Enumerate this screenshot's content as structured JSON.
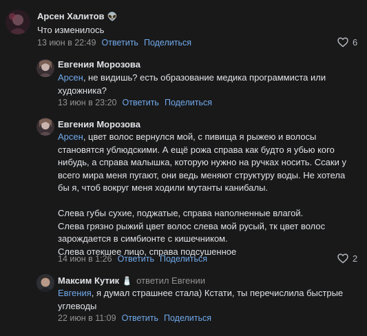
{
  "comments": [
    {
      "author": "Арсен Халитов",
      "badge": "👽",
      "text": "Что изменилось",
      "time": "13 июн в 22:49",
      "reply_label": "Ответить",
      "share_label": "Поделиться",
      "likes": "6"
    },
    {
      "author": "Евгения Морозова",
      "mention": "Арсен",
      "text": ", не видишь? есть образование медика программиста или\nхудожника?",
      "time": "13 июн в 23:20",
      "reply_label": "Ответить",
      "share_label": "Поделиться"
    },
    {
      "author": "Евгения Морозова",
      "mention": "Арсен",
      "text": ", цвет волос вернулся мой, с пивища я рыжею и волосы\nстановятся ублюдскими. А ещё рожа справа как будто я убью кого\nнибудь, а справа малышка, которую нужно на ручках носить. Ссаки у\nвсего мира меня пугают, они ведь меняют структуру воды. Не хотела\nбы я, чтоб вокруг меня ходили мутанты канибалы.\n\nСлева губы сухие, поджатые, справа наполненные влагой.\nСлева грязно рыжий цвет волос слева мой русый, тк цвет волос\nзарождается в симбионте с кишечником.\nСлева отекшее лицо, справа подсушенное",
      "time": "14 июн в 1:26",
      "reply_label": "Ответить",
      "share_label": "Поделиться",
      "likes": "2"
    },
    {
      "author": "Максим Кутик",
      "badge": "🧂",
      "replied_to": "ответил Евгении",
      "mention": "Евгения",
      "text": ", я думал страшнее стала) Кстати, ты перечислила быстрые\nуглеводы",
      "time": "22 июн в 11:09",
      "reply_label": "Ответить",
      "share_label": "Поделиться"
    }
  ]
}
